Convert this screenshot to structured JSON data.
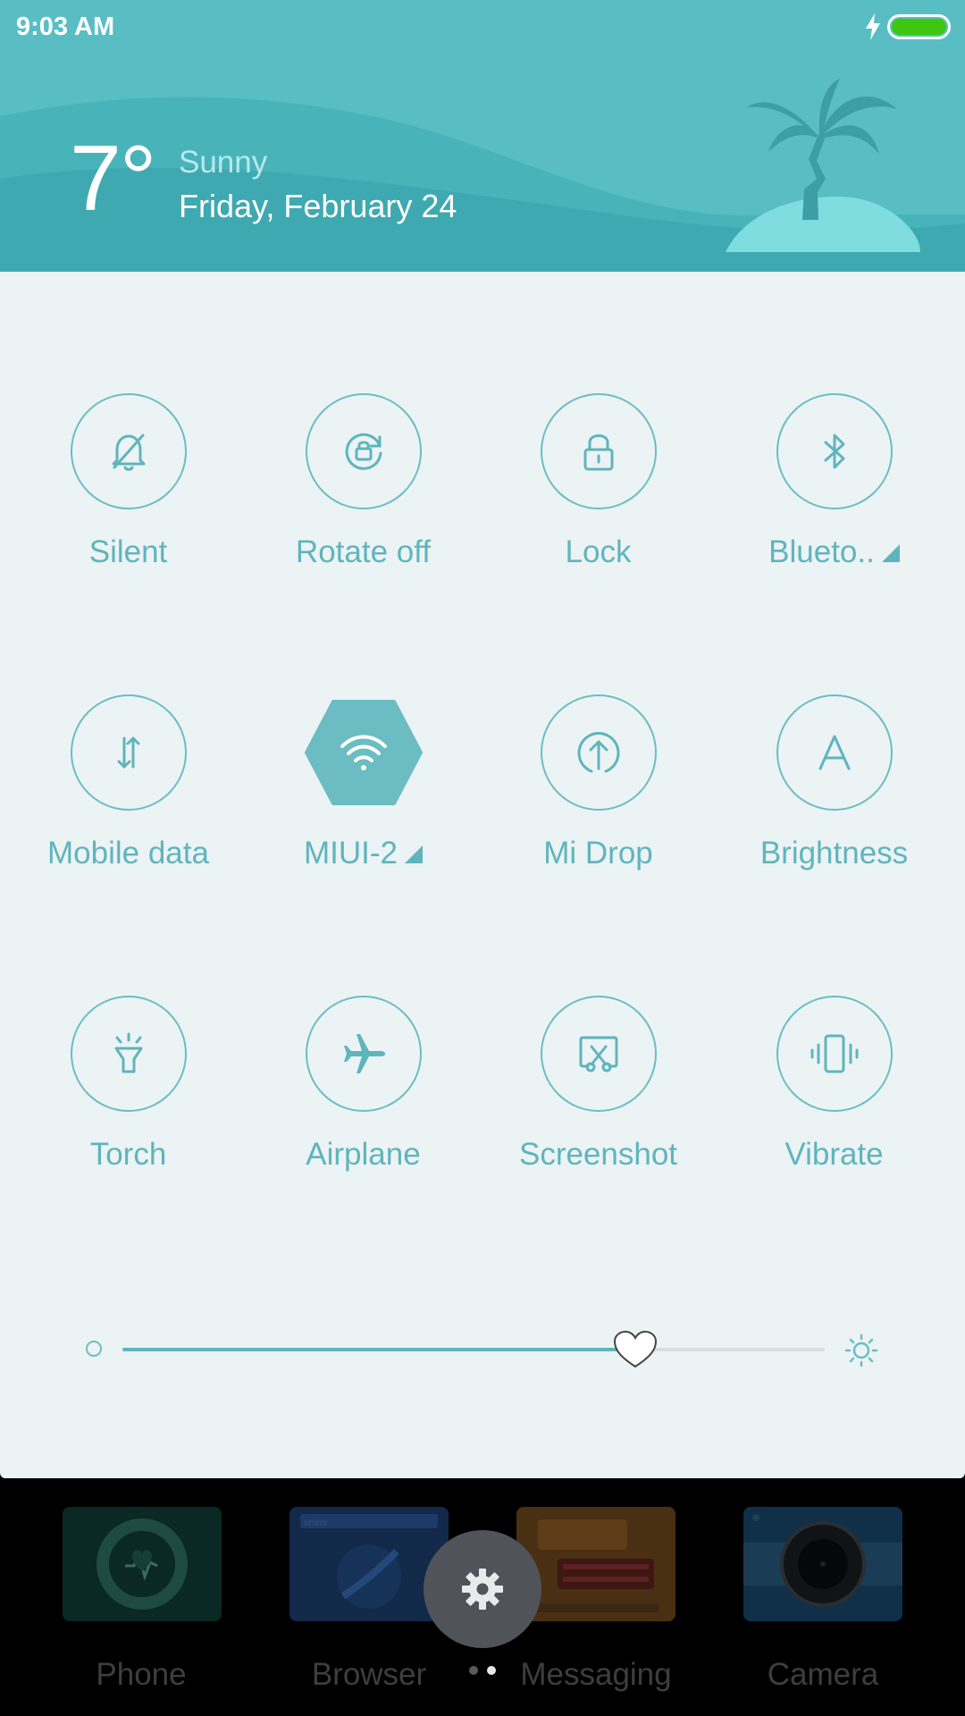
{
  "status_bar": {
    "time": "9:03 AM",
    "battery_level": 1.0
  },
  "weather": {
    "temperature": "7°",
    "condition": "Sunny",
    "date": "Friday, February 24"
  },
  "toggles": [
    {
      "label": "Silent",
      "icon": "bell-off-icon",
      "active": false,
      "expandable": false
    },
    {
      "label": "Rotate off",
      "icon": "rotation-lock-icon",
      "active": false,
      "expandable": false
    },
    {
      "label": "Lock",
      "icon": "lock-icon",
      "active": false,
      "expandable": false
    },
    {
      "label": "Blueto..",
      "icon": "bluetooth-icon",
      "active": false,
      "expandable": true
    },
    {
      "label": "Mobile data",
      "icon": "mobile-data-icon",
      "active": false,
      "expandable": false
    },
    {
      "label": "MIUI-2",
      "icon": "wifi-icon",
      "active": true,
      "expandable": true
    },
    {
      "label": "Mi Drop",
      "icon": "upload-icon",
      "active": false,
      "expandable": false
    },
    {
      "label": "Brightness",
      "icon": "auto-brightness-icon",
      "active": false,
      "expandable": false
    },
    {
      "label": "Torch",
      "icon": "torch-icon",
      "active": false,
      "expandable": false
    },
    {
      "label": "Airplane",
      "icon": "airplane-icon",
      "active": false,
      "expandable": false
    },
    {
      "label": "Screenshot",
      "icon": "screenshot-icon",
      "active": false,
      "expandable": false
    },
    {
      "label": "Vibrate",
      "icon": "vibrate-icon",
      "active": false,
      "expandable": false
    }
  ],
  "brightness": {
    "level": 0.73
  },
  "dock": {
    "apps": [
      {
        "label": "Phone",
        "icon": "phone-icon"
      },
      {
        "label": "Browser",
        "icon": "browser-icon"
      },
      {
        "label": "Messaging",
        "icon": "messaging-icon"
      },
      {
        "label": "Camera",
        "icon": "camera-icon"
      }
    ],
    "page_count": 2,
    "current_page": 2
  },
  "colors": {
    "accent": "#5fb5bc",
    "header": "#59bec4",
    "panel": "#ecf3f5",
    "battery": "#3ec70e"
  }
}
